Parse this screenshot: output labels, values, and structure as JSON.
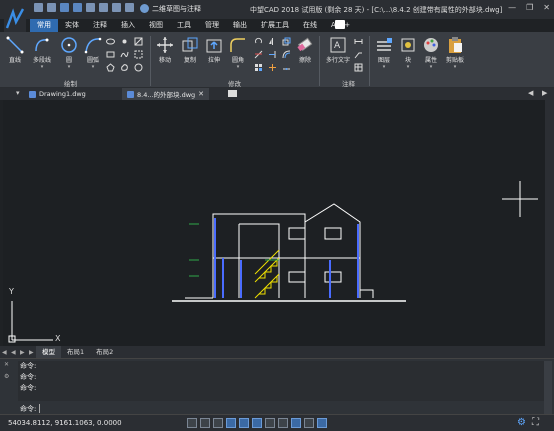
{
  "titlebar": {
    "workspace": "二维草图与注释",
    "title": "中望CAD 2018 试用版 (剩余 28 天) - [C:\\...\\8.4.2 创建带有属性的外部块.dwg]",
    "minimize": "—",
    "maximize": "❐",
    "close": "✕"
  },
  "menu": [
    "常用",
    "实体",
    "注释",
    "插入",
    "视图",
    "工具",
    "管理",
    "输出",
    "扩展工具",
    "在线",
    "APP+"
  ],
  "ribbon": {
    "draw": {
      "group": "绘制",
      "line": "直线",
      "polyline": "多段线",
      "circle": "圆",
      "arc": "圆弧"
    },
    "modify": {
      "group": "修改",
      "move": "移动",
      "copy": "复制",
      "stretch": "拉伸",
      "fillet": "圆角",
      "erase": "擦除"
    },
    "annotate": {
      "group": "注释",
      "mtext": "多行文字"
    },
    "layers": "图层",
    "block": "块",
    "properties": "属性",
    "clipboard": "剪贴板"
  },
  "doc_tabs": [
    {
      "label": "Drawing1.dwg"
    },
    {
      "label": "8.4...的外部块.dwg"
    }
  ],
  "ucs": {
    "x": "X",
    "y": "Y"
  },
  "layout_tabs": [
    "模型",
    "布局1",
    "布局2"
  ],
  "command": {
    "history": [
      "命令:",
      "命令:",
      "命令:"
    ],
    "prompt": "命令:"
  },
  "status": {
    "coordinates": "54034.8112, 9161.1063, 0.0000"
  },
  "colors": {
    "accent": "#2f6bb0",
    "canvas": "#1d2023",
    "ribbon": "#3a3e44",
    "drawing_white": "#ffffff",
    "drawing_yellow": "#f0e000",
    "drawing_blue": "#4a6cff",
    "drawing_green": "#2ea84a"
  },
  "icons": {
    "logo": "zwcad-logo-icon",
    "crosshair": "crosshair-cursor"
  }
}
